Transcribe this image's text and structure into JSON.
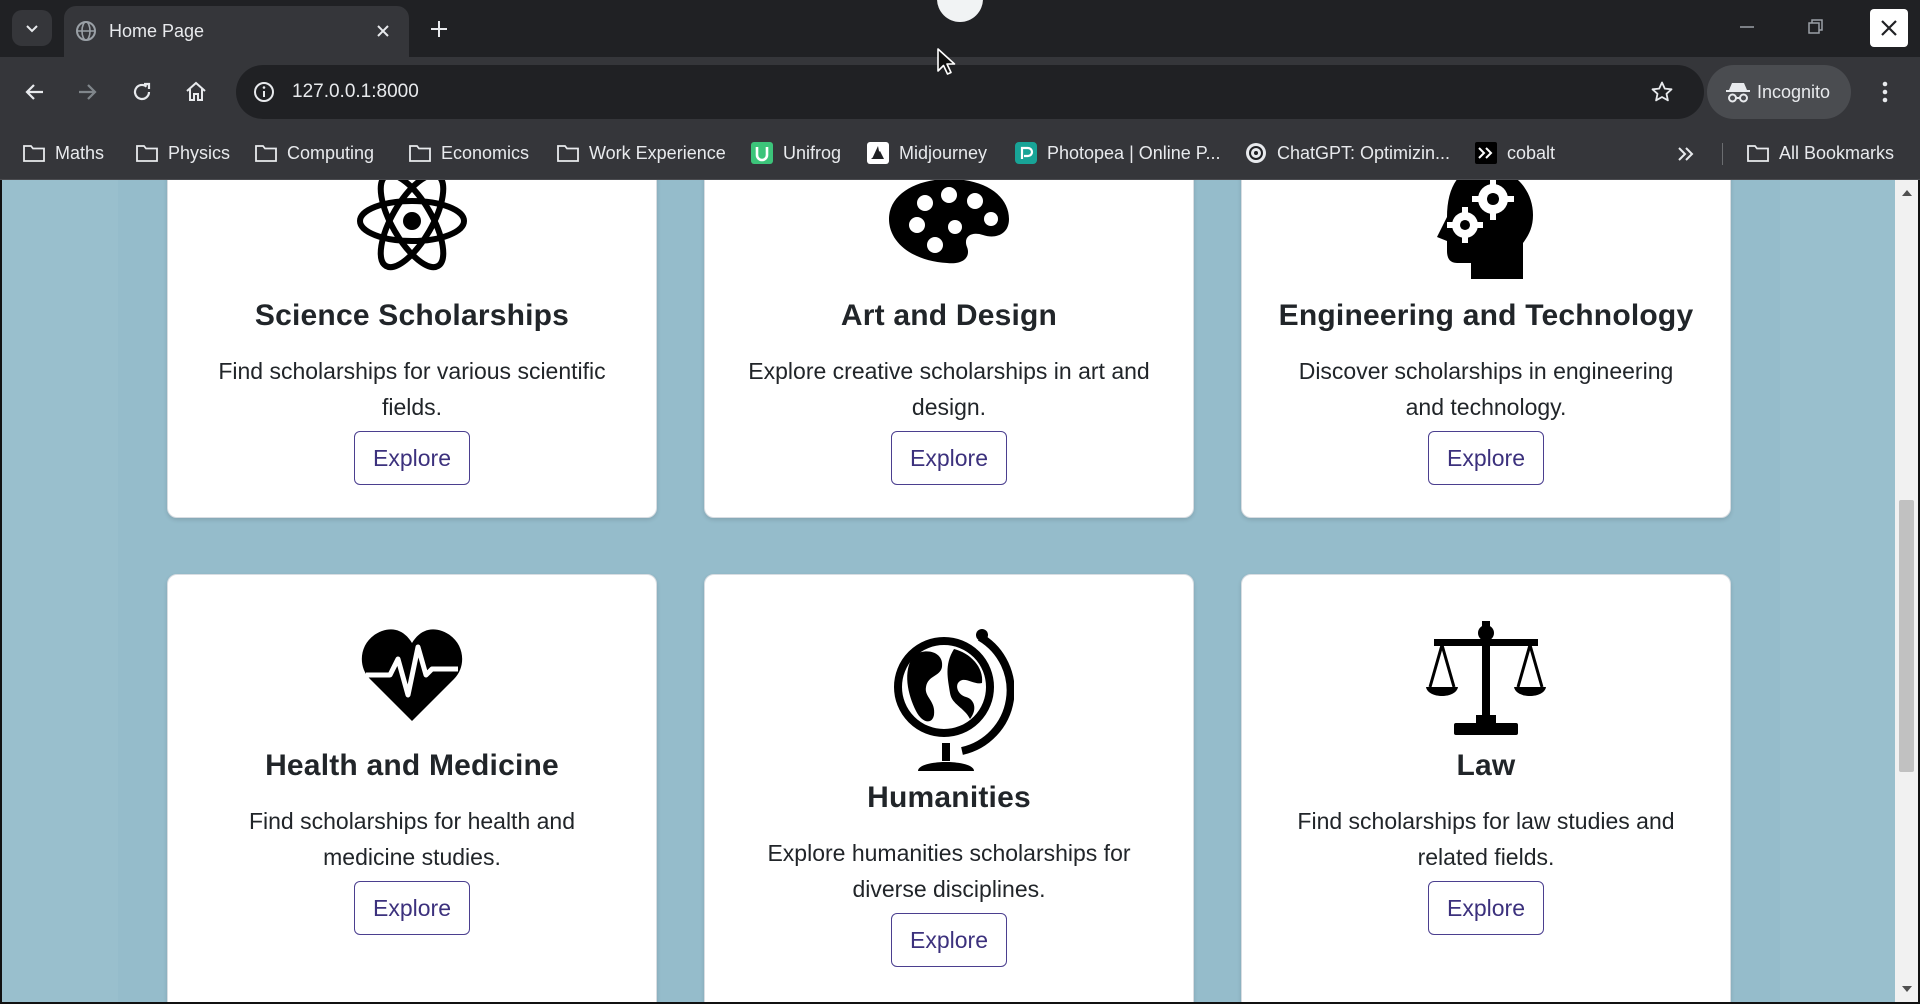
{
  "browser": {
    "tab_title": "Home Page",
    "url": "127.0.0.1:8000",
    "profile_label": "Incognito"
  },
  "bookmarks": {
    "items": [
      {
        "label": "Maths",
        "icon": "folder-icon"
      },
      {
        "label": "Physics",
        "icon": "folder-icon"
      },
      {
        "label": "Computing",
        "icon": "folder-icon"
      },
      {
        "label": "Economics",
        "icon": "folder-icon"
      },
      {
        "label": "Work Experience",
        "icon": "folder-icon"
      },
      {
        "label": "Unifrog",
        "icon": "unifrog-icon"
      },
      {
        "label": "Midjourney",
        "icon": "midjourney-icon"
      },
      {
        "label": "Photopea | Online P...",
        "icon": "photopea-icon"
      },
      {
        "label": "ChatGPT: Optimizin...",
        "icon": "chatgpt-icon"
      },
      {
        "label": "cobalt",
        "icon": "cobalt-icon"
      }
    ],
    "all_bookmarks_label": "All Bookmarks"
  },
  "cards": [
    {
      "title": "Science Scholarships",
      "description": "Find scholarships for various scientific fields.",
      "button": "Explore",
      "icon": "atom-icon"
    },
    {
      "title": "Art and Design",
      "description": "Explore creative scholarships in art and design.",
      "button": "Explore",
      "icon": "palette-icon"
    },
    {
      "title": "Engineering and Technology",
      "description": "Discover scholarships in engineering and technology.",
      "button": "Explore",
      "icon": "head-gears-icon"
    },
    {
      "title": "Health and Medicine",
      "description": "Find scholarships for health and medicine studies.",
      "button": "Explore",
      "icon": "heartbeat-icon"
    },
    {
      "title": "Humanities",
      "description": "Explore humanities scholarships for diverse disciplines.",
      "button": "Explore",
      "icon": "globe-icon"
    },
    {
      "title": "Law",
      "description": "Find scholarships for law studies and related fields.",
      "button": "Explore",
      "icon": "scales-icon"
    }
  ],
  "colors": {
    "page_background": "#99bfcd",
    "card_background": "#ffffff",
    "button_accent": "#3c317d"
  }
}
